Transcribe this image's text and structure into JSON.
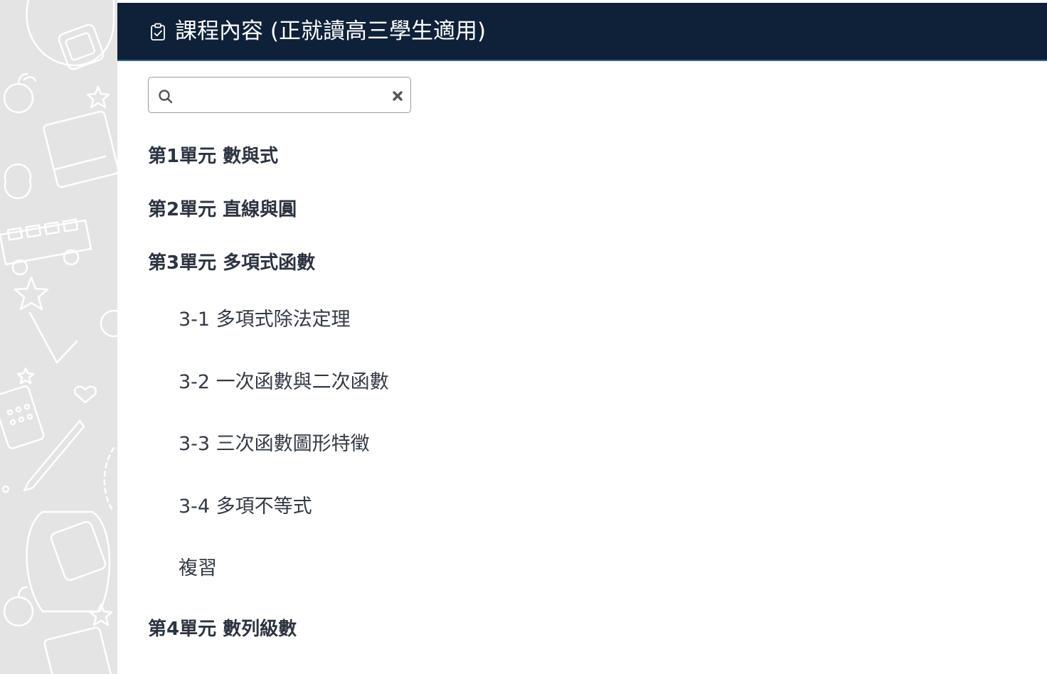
{
  "header": {
    "title": "課程內容 (正就讀高三學生適用)",
    "icon": "clipboard-check-icon"
  },
  "search": {
    "value": "",
    "placeholder": "",
    "icon": "search-icon",
    "clear_icon": "close-icon"
  },
  "outline": {
    "units": [
      {
        "label": "第1單元 數與式"
      },
      {
        "label": "第2單元 直線與圓"
      },
      {
        "label": "第3單元 多項式函數",
        "lessons": [
          {
            "label": "3-1 多項式除法定理"
          },
          {
            "label": "3-2 一次函數與二次函數"
          },
          {
            "label": "3-3 三次函數圖形特徵"
          },
          {
            "label": "3-4 多項不等式"
          },
          {
            "label": "複習"
          }
        ]
      },
      {
        "label": "第4單元 數列級數"
      }
    ]
  },
  "colors": {
    "header_bg": "#0e2138",
    "header_text": "#ffffff",
    "unit_text": "#2c3340",
    "lesson_text": "#333a45",
    "side_bg": "#e4e4e4"
  }
}
